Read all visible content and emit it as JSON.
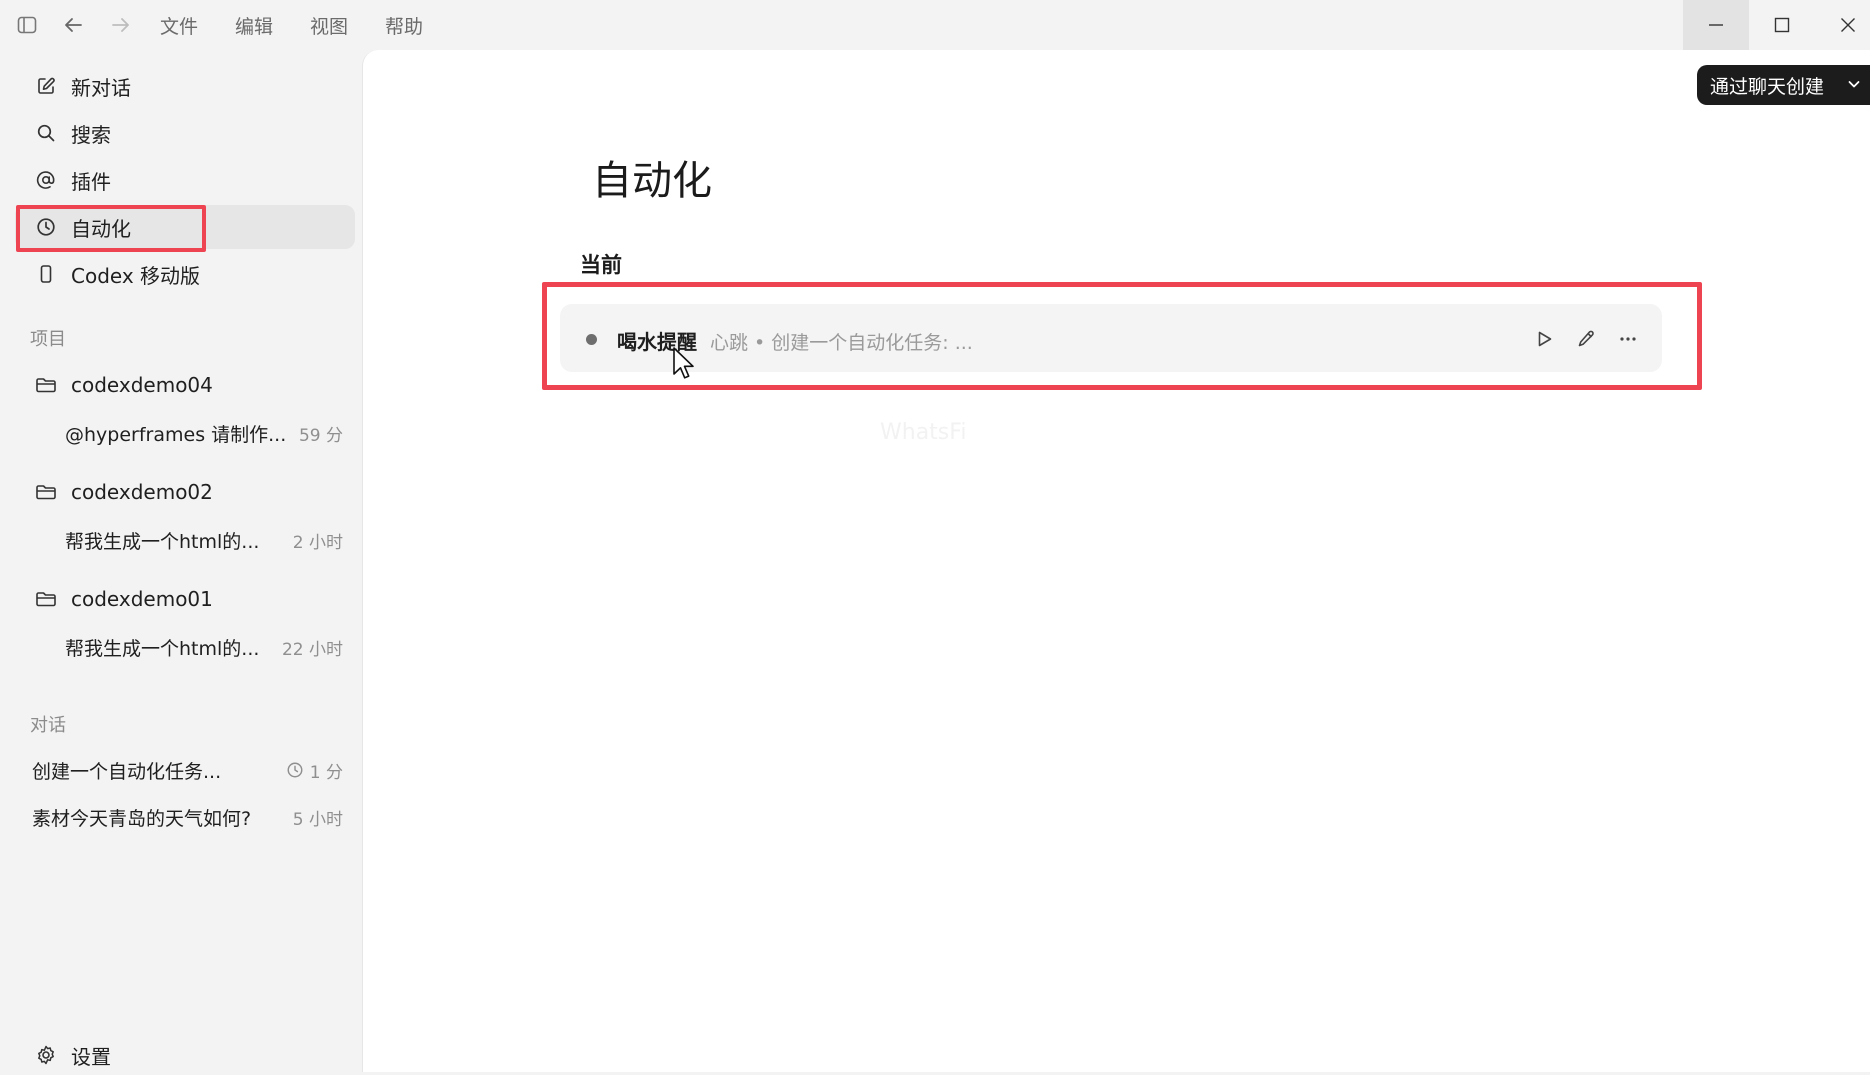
{
  "titlebar": {
    "menu": [
      "文件",
      "编辑",
      "视图",
      "帮助"
    ]
  },
  "sidebar": {
    "nav": [
      {
        "label": "新对话",
        "icon": "edit-icon"
      },
      {
        "label": "搜索",
        "icon": "search-icon"
      },
      {
        "label": "插件",
        "icon": "at-icon"
      },
      {
        "label": "自动化",
        "icon": "clock-icon",
        "active": true
      },
      {
        "label": "Codex 移动版",
        "icon": "phone-icon"
      }
    ],
    "projects_label": "项目",
    "projects": [
      {
        "name": "codexdemo04",
        "thread": "@hyperframes 请制作...",
        "time": "59 分"
      },
      {
        "name": "codexdemo02",
        "thread": "帮我生成一个html的...",
        "time": "2 小时"
      },
      {
        "name": "codexdemo01",
        "thread": "帮我生成一个html的...",
        "time": "22 小时"
      }
    ],
    "conversations_label": "对话",
    "conversations": [
      {
        "title": "创建一个自动化任务...",
        "time": "1 分",
        "scheduled": true
      },
      {
        "title": "素材今天青岛的天气如何?",
        "time": "5 小时",
        "scheduled": false
      }
    ],
    "settings_label": "设置"
  },
  "main": {
    "create_button": "通过聊天创建",
    "title": "自动化",
    "current_label": "当前",
    "automation": {
      "name": "喝水提醒",
      "description": "心跳 • 创建一个自动化任务: ..."
    },
    "watermark": "WhatsFi"
  },
  "colors": {
    "highlight": "#ee4452",
    "active_nav": "#e6e6e6",
    "create_button_bg": "#1c1c1c"
  }
}
